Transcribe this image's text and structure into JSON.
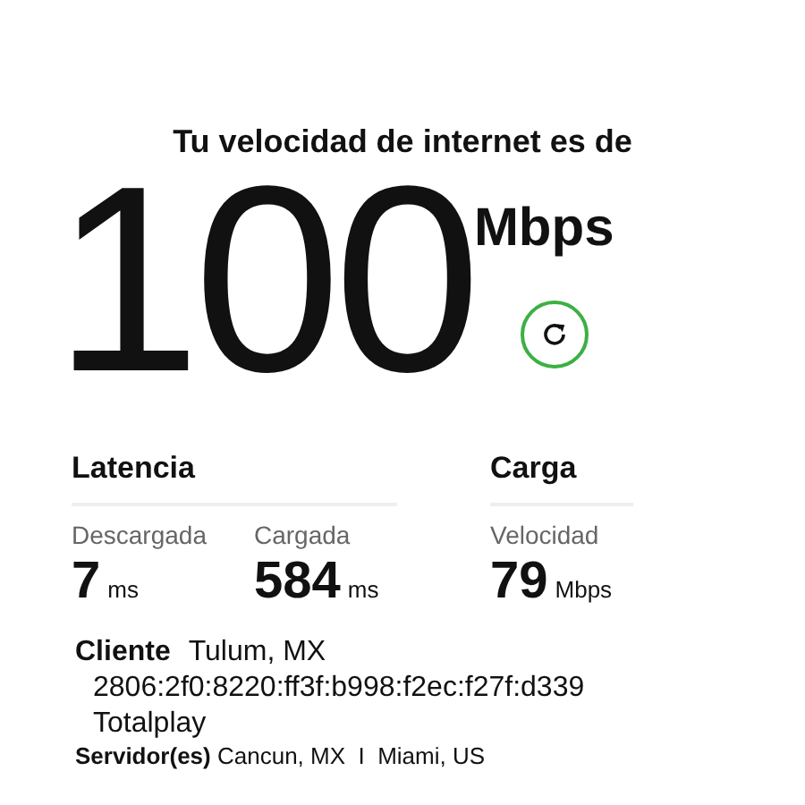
{
  "title": "Tu velocidad de internet es de",
  "speed": {
    "value": "100",
    "unit": "Mbps"
  },
  "sections": [
    {
      "heading": "Latencia",
      "metrics": [
        {
          "label": "Descargada",
          "value": "7",
          "unit": "ms"
        },
        {
          "label": "Cargada",
          "value": "584",
          "unit": "ms"
        }
      ]
    },
    {
      "heading": "Carga",
      "metrics": [
        {
          "label": "Velocidad",
          "value": "79",
          "unit": "Mbps"
        }
      ]
    }
  ],
  "client": {
    "label": "Cliente",
    "location": "Tulum, MX",
    "ip": "2806:2f0:8220:ff3f:b998:f2ec:f27f:d339",
    "isp": "Totalplay"
  },
  "servers": "**Servidor(es)** Cancun, MX  I  Miami, US"
}
